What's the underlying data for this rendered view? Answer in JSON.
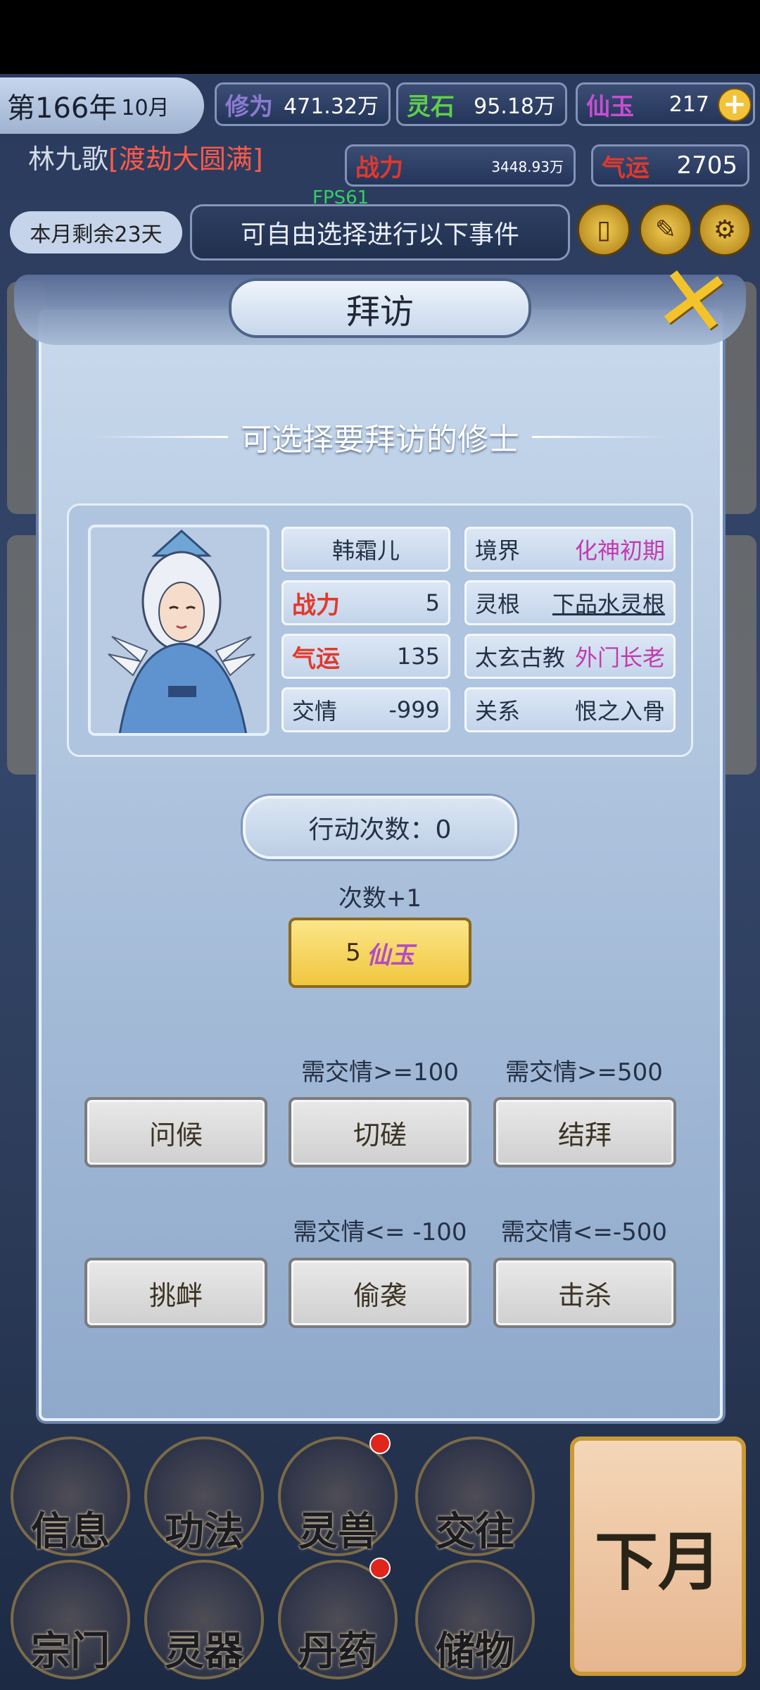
{
  "status": {
    "year": "第166年",
    "month": "10月",
    "cultivation_label": "修为",
    "cultivation_value": "471.32万",
    "spirit_stone_label": "灵石",
    "spirit_stone_value": "95.18万",
    "jade_label": "仙玉",
    "jade_value": "217",
    "player_name": "林九歌",
    "player_realm": "渡劫大圆满",
    "power_label": "战力",
    "power_value": "3448.93万",
    "luck_label": "气运",
    "luck_value": "2705",
    "fps": "FPS61",
    "remaining_days": "本月剩余23天",
    "event_text": "可自由选择进行以下事件"
  },
  "modal": {
    "title": "拜访",
    "subtitle": "可选择要拜访的修士",
    "npc": {
      "name": "韩霜儿",
      "realm_label": "境界",
      "realm_value": "化神初期",
      "power_label": "战力",
      "power_value": "5",
      "root_label": "灵根",
      "root_value": "下品水灵根",
      "luck_label": "气运",
      "luck_value": "135",
      "sect_name": "太玄古教",
      "sect_role": "外门长老",
      "friendship_label": "交情",
      "friendship_value": "-999",
      "relation_label": "关系",
      "relation_value": "恨之入骨"
    },
    "action_count": "行动次数：0",
    "plus_label": "次数+1",
    "buy_cost": "5",
    "buy_currency": "仙玉",
    "requirements": {
      "spar": "需交情>=100",
      "sworn": "需交情>=500",
      "sneak": "需交情<= -100",
      "kill": "需交情<=-500"
    },
    "buttons": {
      "greet": "问候",
      "spar": "切磋",
      "sworn": "结拜",
      "provoke": "挑衅",
      "sneak": "偷袭",
      "kill": "击杀"
    }
  },
  "menu": {
    "info": "信息",
    "skills": "功法",
    "beasts": "灵兽",
    "social": "交往",
    "sect": "宗门",
    "artifacts": "灵器",
    "pills": "丹药",
    "storage": "储物",
    "next_month": "下月"
  }
}
